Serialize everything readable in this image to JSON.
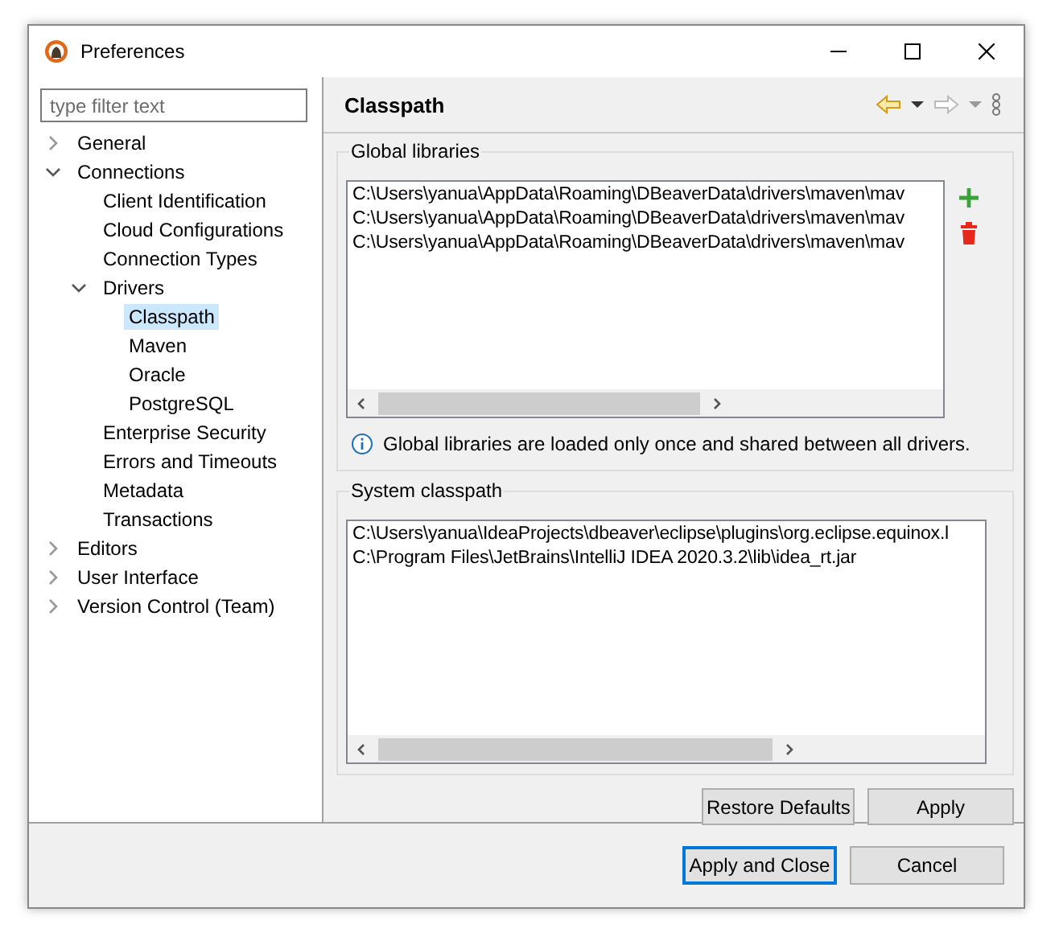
{
  "window": {
    "title": "Preferences"
  },
  "filter": {
    "placeholder": "type filter text"
  },
  "tree": [
    {
      "label": "General",
      "expanded": false,
      "selected": false
    },
    {
      "label": "Connections",
      "expanded": true,
      "selected": false,
      "children": [
        {
          "label": "Client Identification",
          "selected": false
        },
        {
          "label": "Cloud Configurations",
          "selected": false
        },
        {
          "label": "Connection Types",
          "selected": false
        },
        {
          "label": "Drivers",
          "expanded": true,
          "selected": false,
          "children": [
            {
              "label": "Classpath",
              "selected": true
            },
            {
              "label": "Maven",
              "selected": false
            },
            {
              "label": "Oracle",
              "selected": false
            },
            {
              "label": "PostgreSQL",
              "selected": false
            }
          ]
        },
        {
          "label": "Enterprise Security",
          "selected": false
        },
        {
          "label": "Errors and Timeouts",
          "selected": false
        },
        {
          "label": "Metadata",
          "selected": false
        },
        {
          "label": "Transactions",
          "selected": false
        }
      ]
    },
    {
      "label": "Editors",
      "expanded": false,
      "selected": false
    },
    {
      "label": "User Interface",
      "expanded": false,
      "selected": false
    },
    {
      "label": "Version Control (Team)",
      "expanded": false,
      "selected": false
    }
  ],
  "page": {
    "title": "Classpath"
  },
  "global_libraries": {
    "title": "Global libraries",
    "items": [
      "C:\\Users\\yanua\\AppData\\Roaming\\DBeaverData\\drivers\\maven\\mav",
      "C:\\Users\\yanua\\AppData\\Roaming\\DBeaverData\\drivers\\maven\\mav",
      "C:\\Users\\yanua\\AppData\\Roaming\\DBeaverData\\drivers\\maven\\mav"
    ],
    "info": "Global libraries are loaded only once and shared between all drivers."
  },
  "system_classpath": {
    "title": "System classpath",
    "items": [
      "C:\\Users\\yanua\\IdeaProjects\\dbeaver\\eclipse\\plugins\\org.eclipse.equinox.l",
      "C:\\Program Files\\JetBrains\\IntelliJ IDEA 2020.3.2\\lib\\idea_rt.jar"
    ]
  },
  "page_buttons": [
    "Restore Defaults",
    "Apply"
  ],
  "dialog_buttons": [
    {
      "label": "Apply and Close",
      "default": true
    },
    {
      "label": "Cancel",
      "default": false
    }
  ]
}
